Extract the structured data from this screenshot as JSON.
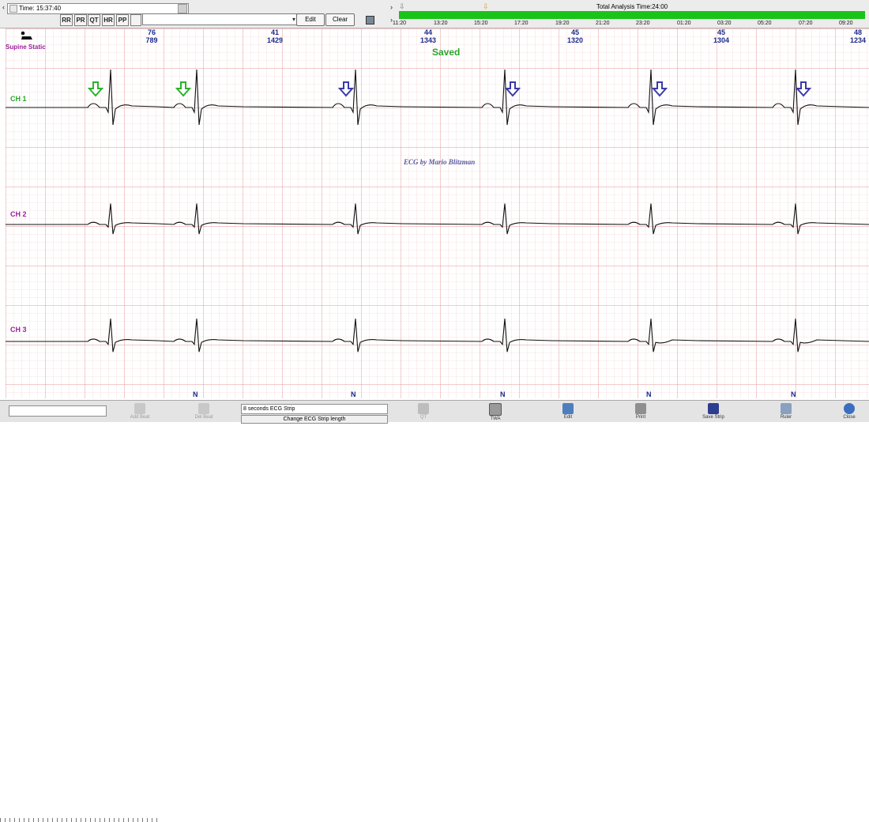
{
  "top_toolbar": {
    "time_label": "Time: 15:37:40",
    "measure_buttons": [
      "RR",
      "PR",
      "QT",
      "HR",
      "PP"
    ],
    "combo_value": "",
    "edit_label": "Edit",
    "clear_label": "Clear"
  },
  "timeline": {
    "title": "Total Analysis Time:24:00",
    "ticks": [
      "11:20",
      "13:20",
      "15:20",
      "17:20",
      "19:20",
      "21:20",
      "23:20",
      "01:20",
      "03:20",
      "05:20",
      "07:20",
      "09:20"
    ],
    "accent_color": "#19c319"
  },
  "header": {
    "position_label": "Supine Static",
    "saved_label": "Saved",
    "watermark": "ECG by Mario Blitzman",
    "hr_values": [
      {
        "top": "76",
        "bottom": "789"
      },
      {
        "top": "41",
        "bottom": "1429"
      },
      {
        "top": "44",
        "bottom": "1343"
      },
      {
        "top": "45",
        "bottom": "1320"
      },
      {
        "top": "45",
        "bottom": "1304"
      },
      {
        "top": "48",
        "bottom": "1234"
      }
    ]
  },
  "channels": [
    {
      "label": "CH 1",
      "color": "#2aa52a"
    },
    {
      "label": "CH 2",
      "color": "#9b1f9b"
    },
    {
      "label": "CH 3",
      "color": "#9b1f9b"
    }
  ],
  "annotations": {
    "arrows": [
      {
        "color": "green"
      },
      {
        "color": "green"
      },
      {
        "color": "blue"
      },
      {
        "color": "blue"
      },
      {
        "color": "blue"
      },
      {
        "color": "blue"
      }
    ]
  },
  "beat_labels": [
    "N",
    "N",
    "N",
    "N",
    "N"
  ],
  "bottom_toolbar": {
    "strip_value": "8 seconds ECG Strip",
    "change_strip_label": "Change ECG Strip length",
    "tools": [
      "Add Beat",
      "Del Beat",
      "QT",
      "TWA",
      "Edit",
      "Print",
      "Save Strip",
      "Ruler",
      "Close"
    ]
  },
  "colors": {
    "grid_major": "#e59494",
    "grid_minor": "#f2cccc",
    "trace": "#111111",
    "hr_text": "#1a2a8c",
    "arrow_green": "#2bb42b",
    "arrow_blue": "#3a3aaa"
  }
}
